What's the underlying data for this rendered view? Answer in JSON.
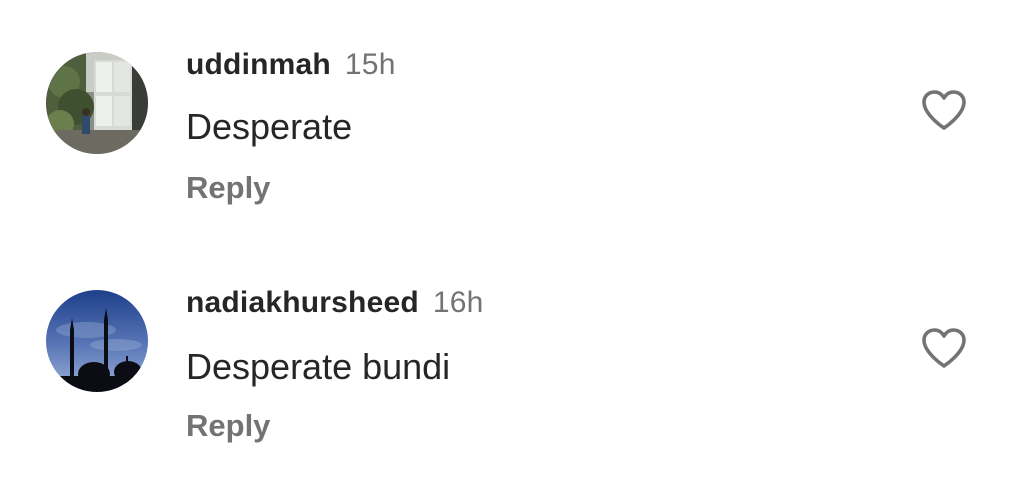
{
  "comments": [
    {
      "username": "uddinmah",
      "time": "15h",
      "text": "Desperate",
      "reply_label": "Reply",
      "avatar": "garden-courtyard-photo",
      "like_icon": "heart-outline-icon"
    },
    {
      "username": "nadiakhursheed",
      "time": "16h",
      "text": "Desperate bundi",
      "reply_label": "Reply",
      "avatar": "mosque-silhouette-night-photo",
      "like_icon": "heart-outline-icon"
    }
  ],
  "colors": {
    "primary_text": "#262626",
    "secondary_text": "#737373",
    "background": "#ffffff"
  }
}
